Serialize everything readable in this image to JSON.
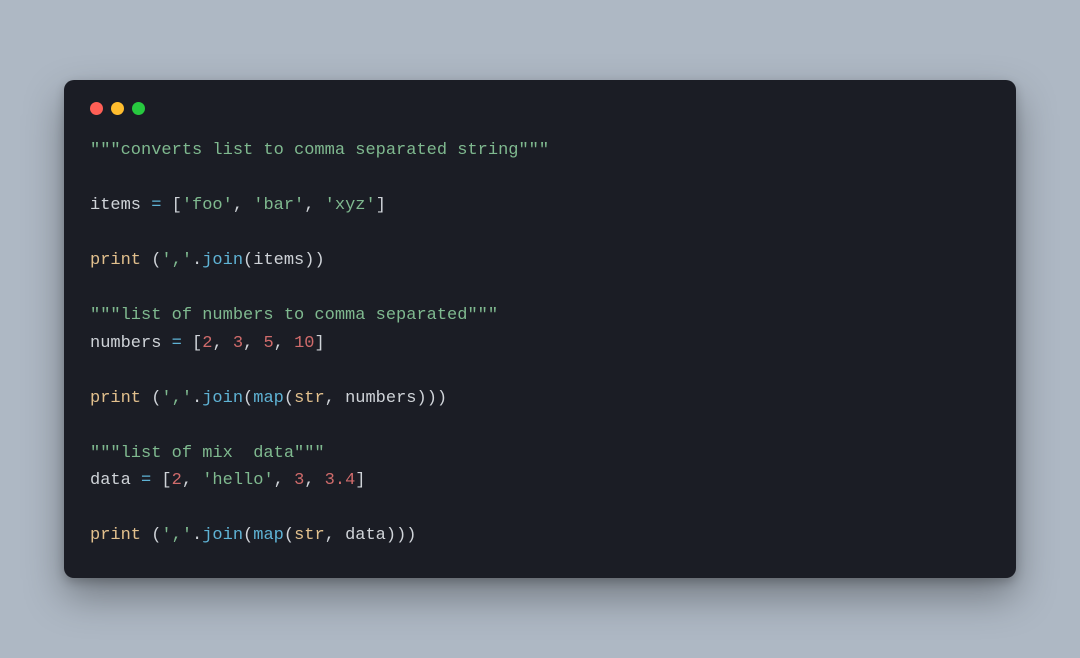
{
  "traffic_light_colors": {
    "close": "#ff5f56",
    "minimize": "#ffbd2e",
    "zoom": "#27c93f"
  },
  "code": {
    "l1": {
      "docstring": "\"\"\"converts list to comma separated string\"\"\""
    },
    "l2": "",
    "l3": {
      "id": "items",
      "eq": " = ",
      "lb": "[",
      "s1": "'foo'",
      "c1": ", ",
      "s2": "'bar'",
      "c2": ", ",
      "s3": "'xyz'",
      "rb": "]"
    },
    "l4": "",
    "l5": {
      "print": "print",
      "sp": " ",
      "lp": "(",
      "sep": "','",
      "dot": ".",
      "join": "join",
      "lp2": "(",
      "arg": "items",
      "rp2": ")",
      "rp": ")"
    },
    "l6": "",
    "l7": {
      "docstring": "\"\"\"list of numbers to comma separated\"\"\""
    },
    "l8": {
      "id": "numbers",
      "eq": " = ",
      "lb": "[",
      "n1": "2",
      "c1": ", ",
      "n2": "3",
      "c2": ", ",
      "n3": "5",
      "c3": ", ",
      "n4": "10",
      "rb": "]"
    },
    "l9": "",
    "l10": {
      "print": "print",
      "sp": " ",
      "lp": "(",
      "sep": "','",
      "dot": ".",
      "join": "join",
      "lp2": "(",
      "map": "map",
      "lp3": "(",
      "str": "str",
      "c": ", ",
      "arg": "numbers",
      "rp3": ")",
      "rp2": ")",
      "rp": ")"
    },
    "l11": "",
    "l12": {
      "docstring": "\"\"\"list of mix  data\"\"\""
    },
    "l13": {
      "id": "data",
      "eq": " = ",
      "lb": "[",
      "n1": "2",
      "c1": ", ",
      "s1": "'hello'",
      "c2": ", ",
      "n2": "3",
      "c3": ", ",
      "n3": "3.4",
      "rb": "]"
    },
    "l14": "",
    "l15": {
      "print": "print",
      "sp": " ",
      "lp": "(",
      "sep": "','",
      "dot": ".",
      "join": "join",
      "lp2": "(",
      "map": "map",
      "lp3": "(",
      "str": "str",
      "c": ", ",
      "arg": "data",
      "rp3": ")",
      "rp2": ")",
      "rp": ")"
    }
  }
}
